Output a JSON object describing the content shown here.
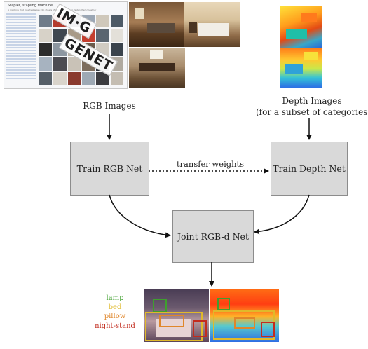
{
  "imagenet": {
    "title": "Stapler, stapling machine",
    "subtitle": "A machine that inserts staples into sheets of paper in order to fasten them together",
    "logo_line1": "IM·G",
    "logo_line2": "GENET"
  },
  "labels": {
    "rgb_images": "RGB Images",
    "depth_images_line1": "Depth Images",
    "depth_images_line2": "(for a subset of categories)",
    "transfer_weights": "transfer weights"
  },
  "boxes": {
    "train_rgb": "Train RGB Net",
    "train_depth": "Train Depth Net",
    "joint": "Joint RGB-d Net"
  },
  "legend": {
    "lamp": "lamp",
    "bed": "bed",
    "pillow": "pillow",
    "nightstand": "night-stand"
  },
  "colors": {
    "lamp": "#3f9f2e",
    "bed": "#e0b92a",
    "pillow": "#e0862a",
    "nightstand": "#c22c1e",
    "box_fill": "#d9d9d9",
    "box_border": "#8c8c8c"
  }
}
